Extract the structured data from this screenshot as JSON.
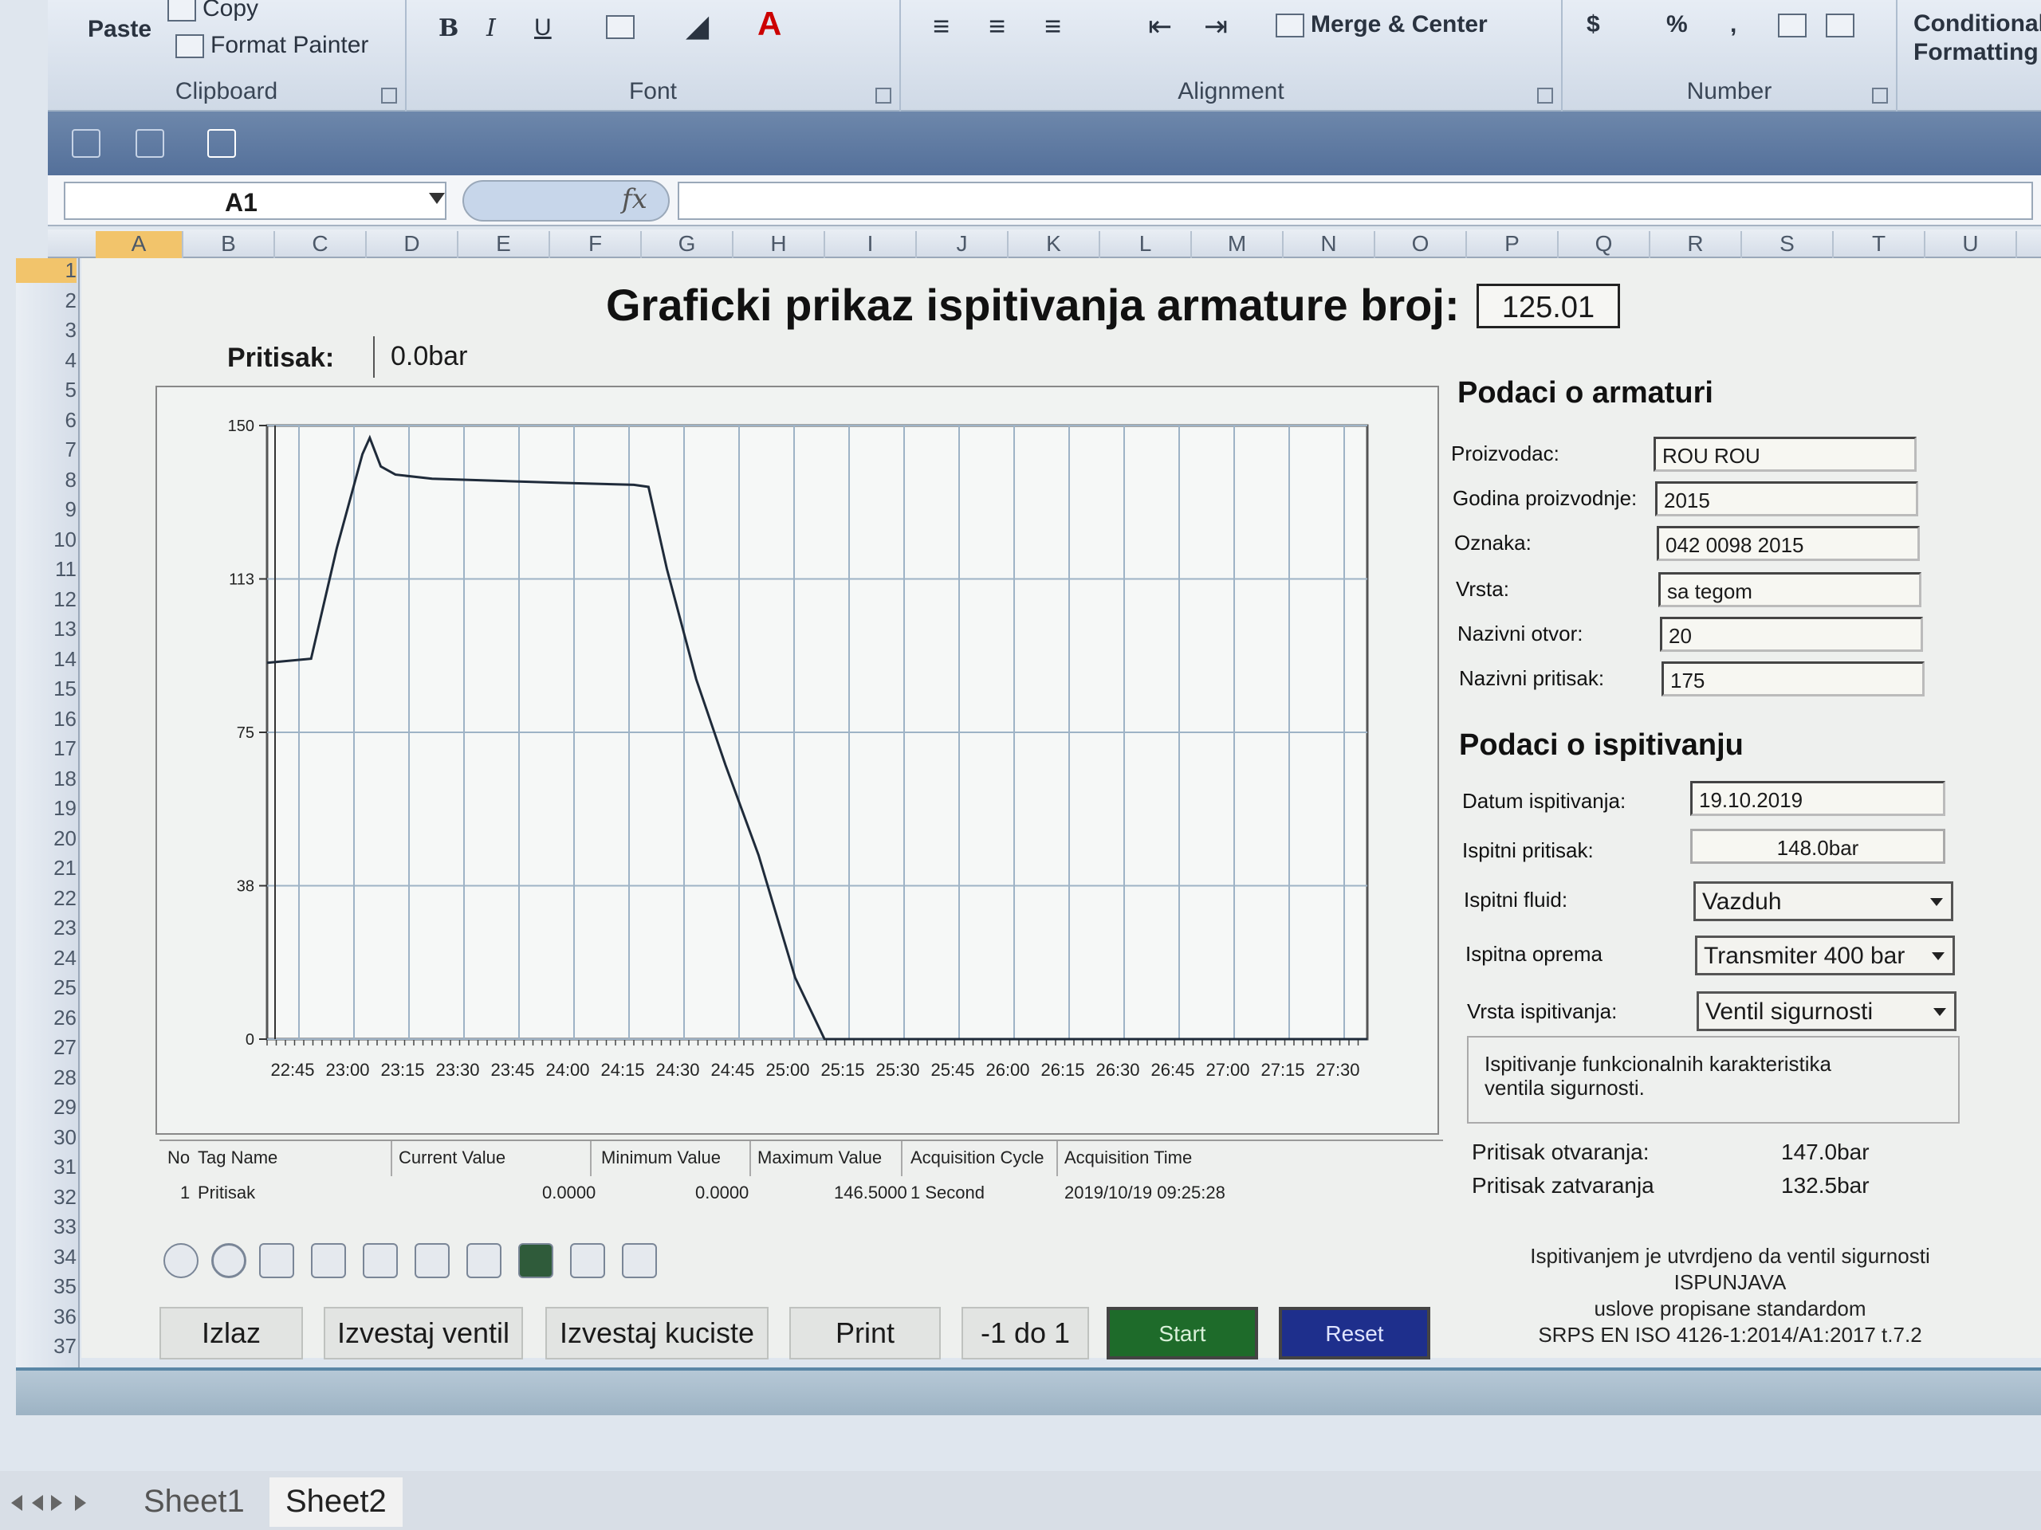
{
  "ribbon": {
    "clipboard": {
      "paste": "Paste",
      "copy": "Copy",
      "format_painter": "Format Painter",
      "label": "Clipboard"
    },
    "font": {
      "bold": "B",
      "italic": "I",
      "underline": "U",
      "label": "Font"
    },
    "alignment": {
      "merge_center": "Merge & Center",
      "label": "Alignment"
    },
    "number": {
      "currency": "$",
      "percent": "%",
      "comma": ",",
      "label": "Number"
    },
    "styles": {
      "conditional_formatting": "Conditional Formatting"
    }
  },
  "formula_bar": {
    "name_box": "A1",
    "fx": "fx"
  },
  "columns": [
    "A",
    "B",
    "C",
    "D",
    "E",
    "F",
    "G",
    "H",
    "I",
    "J",
    "K",
    "L",
    "M",
    "N",
    "O",
    "P",
    "Q",
    "R",
    "S",
    "T",
    "U"
  ],
  "rows": [
    "1",
    "2",
    "3",
    "4",
    "5",
    "6",
    "7",
    "8",
    "9",
    "10",
    "11",
    "12",
    "13",
    "14",
    "15",
    "16",
    "17",
    "18",
    "19",
    "20",
    "21",
    "22",
    "23",
    "24",
    "25",
    "26",
    "27",
    "28",
    "29",
    "30",
    "31",
    "32",
    "33",
    "34",
    "35",
    "36",
    "37"
  ],
  "header": {
    "title": "Graficki prikaz ispitivanja armature broj:",
    "number": "125.01"
  },
  "pressure": {
    "label": "Pritisak:",
    "value": "0.0bar"
  },
  "armature": {
    "title": "Podaci o armaturi",
    "fields": [
      {
        "label": "Proizvodac:",
        "value": "ROU ROU"
      },
      {
        "label": "Godina proizvodnje:",
        "value": "2015"
      },
      {
        "label": "Oznaka:",
        "value": "042 0098 2015"
      },
      {
        "label": "Vrsta:",
        "value": "sa tegom"
      },
      {
        "label": "Nazivni otvor:",
        "value": "20"
      },
      {
        "label": "Nazivni pritisak:",
        "value": "175"
      }
    ]
  },
  "test": {
    "title": "Podaci o ispitivanju",
    "date_label": "Datum ispitivanja:",
    "date_value": "19.10.2019",
    "pressure_label": "Ispitni pritisak:",
    "pressure_value": "148.0bar",
    "fluid_label": "Ispitni fluid:",
    "fluid_value": "Vazduh",
    "equipment_label": "Ispitna oprema",
    "equipment_value": "Transmiter 400 bar",
    "type_label": "Vrsta ispitivanja:",
    "type_value": "Ventil sigurnosti",
    "description": [
      "Ispitivanje funkcionalnih karakteristika",
      "ventila sigurnosti."
    ],
    "open_label": "Pritisak otvaranja:",
    "open_value": "147.0bar",
    "close_label": "Pritisak zatvaranja",
    "close_value": "132.5bar",
    "conclusion": [
      "Ispitivanjem je utvrdjeno da ventil sigurnosti",
      "ISPUNJAVA",
      "uslove propisane standardom",
      "SRPS EN ISO 4126-1:2014/A1:2017 t.7.2"
    ]
  },
  "tag_table": {
    "headers": [
      "No",
      "Tag Name",
      "Current Value",
      "Minimum Value",
      "Maximum Value",
      "Acquisition Cycle",
      "Acquisition Time"
    ],
    "row": [
      "1",
      "Pritisak",
      "0.0000",
      "0.0000",
      "146.5000",
      "1 Second",
      "2019/10/19 09:25:28"
    ]
  },
  "buttons": {
    "exit": "Izlaz",
    "valve_report": "Izvestaj ventil",
    "housing_report": "Izvestaj kuciste",
    "print": "Print",
    "range": "-1 do 1",
    "start": "Start",
    "reset": "Reset"
  },
  "sheet_tabs": [
    "Sheet1",
    "Sheet2"
  ],
  "colors": {
    "start": "#1e6b2a",
    "reset": "#1e2f8c",
    "ribbon": "#cfd9e6"
  },
  "chart_data": {
    "type": "line",
    "title": "",
    "xlabel": "",
    "ylabel": "",
    "y_ticks": [
      "0",
      "38",
      "75",
      "113",
      "150"
    ],
    "ylim": [
      0,
      150
    ],
    "x_ticks": [
      "22:45",
      "23:00",
      "23:15",
      "23:30",
      "23:45",
      "24:00",
      "24:15",
      "24:30",
      "24:45",
      "25:00",
      "25:15",
      "25:30",
      "25:45",
      "26:00",
      "26:15",
      "26:30",
      "26:45",
      "27:00",
      "27:15",
      "27:30"
    ],
    "grid": true,
    "series": [
      {
        "points": [
          [
            0,
            92
          ],
          [
            12,
            93
          ],
          [
            19,
            120
          ],
          [
            26,
            143
          ],
          [
            28,
            147
          ],
          [
            31,
            140
          ],
          [
            35,
            138
          ],
          [
            45,
            137
          ],
          [
            80,
            136
          ],
          [
            100,
            135.5
          ],
          [
            104,
            135
          ],
          [
            109,
            115
          ],
          [
            117,
            88
          ],
          [
            125,
            67
          ],
          [
            134,
            45
          ],
          [
            144,
            15
          ],
          [
            152,
            0
          ],
          [
            300,
            0
          ]
        ]
      }
    ]
  }
}
